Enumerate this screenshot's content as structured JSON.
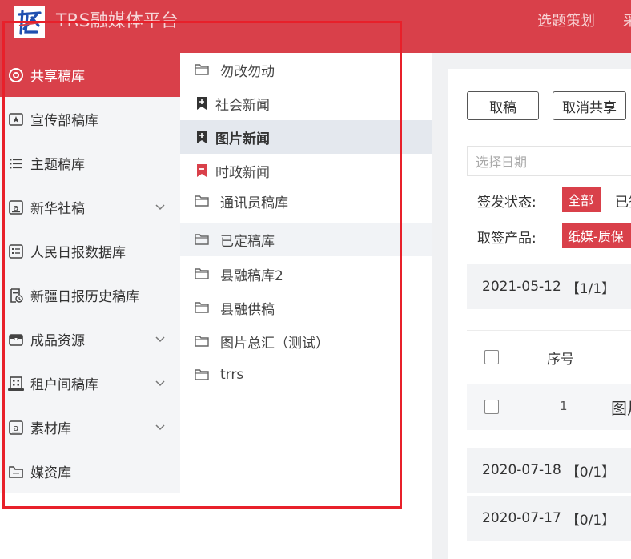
{
  "header": {
    "title": "TRS融媒体平台",
    "nav": [
      "选题策划",
      "采"
    ]
  },
  "sidebar": {
    "items": [
      {
        "label": "共享稿库",
        "icon": "share-circle-icon",
        "active": true,
        "has_children": false
      },
      {
        "label": "宣传部稿库",
        "icon": "star-box-icon",
        "active": false,
        "has_children": false
      },
      {
        "label": "主题稿库",
        "icon": "list-icon",
        "active": false,
        "has_children": false
      },
      {
        "label": "新华社稿",
        "icon": "news-a-icon",
        "active": false,
        "has_children": true
      },
      {
        "label": "人民日报数据库",
        "icon": "checklist-icon",
        "active": false,
        "has_children": false
      },
      {
        "label": "新疆日报历史稿库",
        "icon": "document-clock-icon",
        "active": false,
        "has_children": false
      },
      {
        "label": "成品资源",
        "icon": "package-icon",
        "active": false,
        "has_children": true
      },
      {
        "label": "租户间稿库",
        "icon": "building-icon",
        "active": false,
        "has_children": true
      },
      {
        "label": "素材库",
        "icon": "material-a-icon",
        "active": false,
        "has_children": true
      },
      {
        "label": "媒资库",
        "icon": "folder-media-icon",
        "active": false,
        "has_children": false
      }
    ]
  },
  "library_list": {
    "items": [
      {
        "label": "勿改勿动",
        "icon": "folder-icon",
        "state": "normal"
      },
      {
        "label": "社会新闻",
        "icon": "bookmark-plus-icon",
        "state": "normal"
      },
      {
        "label": "图片新闻",
        "icon": "bookmark-plus-icon",
        "state": "selected"
      },
      {
        "label": "时政新闻",
        "icon": "bookmark-minus-icon",
        "state": "normal"
      },
      {
        "label": "通讯员稿库",
        "icon": "folder-icon",
        "state": "normal"
      },
      {
        "label": "已定稿库",
        "icon": "folder-icon",
        "state": "hover"
      },
      {
        "label": "县融稿库2",
        "icon": "folder-icon",
        "state": "normal"
      },
      {
        "label": "县融供稿",
        "icon": "folder-icon",
        "state": "normal"
      },
      {
        "label": "图片总汇（测试）",
        "icon": "folder-icon",
        "state": "normal"
      },
      {
        "label": "trrs",
        "icon": "folder-icon",
        "state": "normal"
      }
    ]
  },
  "toolbar": {
    "take_label": "取稿",
    "unshare_label": "取消共享"
  },
  "filters": {
    "date_placeholder": "选择日期",
    "status_label": "签发状态:",
    "status_all": "全部",
    "status_next": "已签",
    "product_label": "取签产品:",
    "product_value": "纸媒-质保"
  },
  "groups": [
    {
      "date": "2021-05-12",
      "count": "【1/1】"
    },
    {
      "date": "2020-07-18",
      "count": "【0/1】"
    },
    {
      "date": "2020-07-17",
      "count": "【0/1】"
    }
  ],
  "table": {
    "index_header": "序号",
    "rows": [
      {
        "index": "1",
        "title": "图片"
      }
    ]
  },
  "colors": {
    "brand_red": "#d9404a",
    "annotation_red": "#e8202a",
    "sidebar_bg": "#f4f5f7",
    "selected_bg": "#e4e8ee"
  }
}
